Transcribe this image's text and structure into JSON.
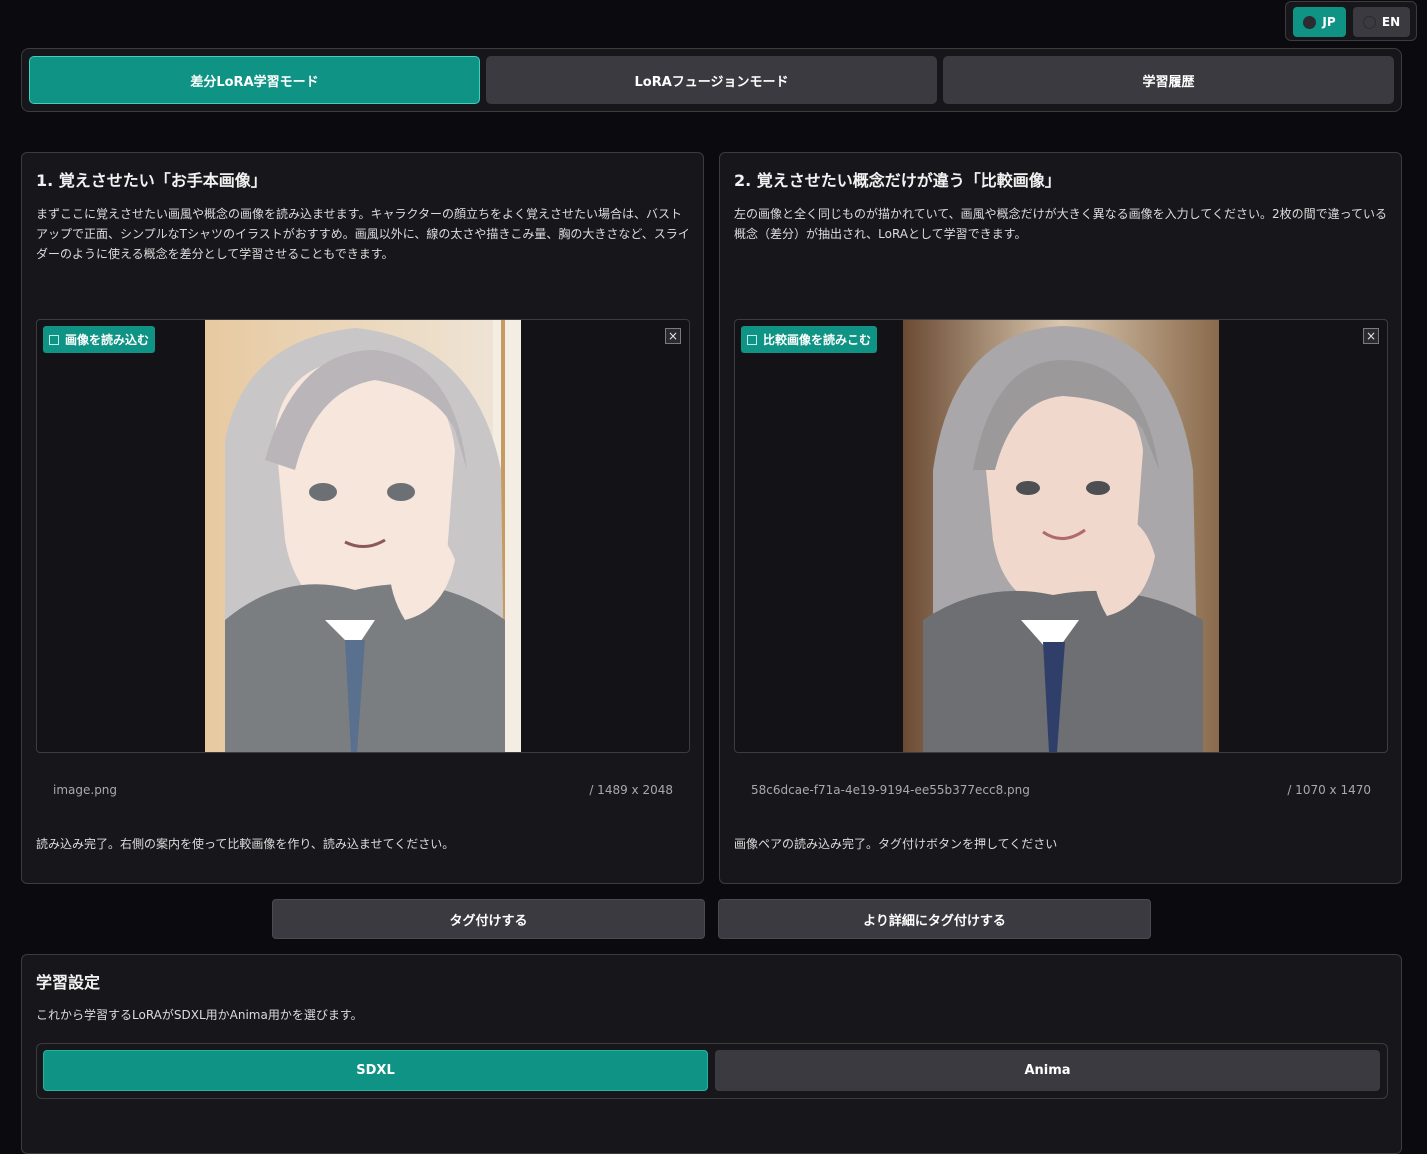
{
  "language": {
    "jp_label": "JP",
    "en_label": "EN",
    "selected": "JP"
  },
  "mode_tabs": [
    {
      "label": "差分LoRA学習モード",
      "active": true
    },
    {
      "label": "LoRAフュージョンモード",
      "active": false
    },
    {
      "label": "学習履歴",
      "active": false
    }
  ],
  "left_panel": {
    "title": "1. 覚えさせたい「お手本画像」",
    "description": "まずここに覚えさせたい画風や概念の画像を読み込ませます。キャラクターの顔立ちをよく覚えさせたい場合は、バストアップで正面、シンプルなTシャツのイラストがおすすめ。画風以外に、線の太さや描きこみ量、胸の大きさなど、スライダーのように使える概念を差分として学習させることもできます。",
    "upload_label": "画像を読み込む",
    "close_icon": "×",
    "filename": "image.png",
    "dimensions": "/ 1489 x 2048",
    "status": "読み込み完了。右側の案内を使って比較画像を作り、読み込ませてください。"
  },
  "right_panel": {
    "title": "2. 覚えさせたい概念だけが違う「比較画像」",
    "description": "左の画像と全く同じものが描かれていて、画風や概念だけが大きく異なる画像を入力してください。2枚の間で違っている概念（差分）が抽出され、LoRAとして学習できます。",
    "upload_label": "比較画像を読みこむ",
    "close_icon": "×",
    "filename": "58c6dcae-f71a-4e19-9194-ee55b377ecc8.png",
    "dimensions": "/ 1070 x 1470",
    "status": "画像ペアの読み込み完了。タグ付けボタンを押してください"
  },
  "tag_buttons": {
    "tag_label": "タグ付けする",
    "detailed_tag_label": "より詳細にタグ付けする"
  },
  "training_settings": {
    "title": "学習設定",
    "description": "これから学習するLoRAがSDXL用かAnima用かを選びます。",
    "models": [
      {
        "label": "SDXL",
        "active": true
      },
      {
        "label": "Anima",
        "active": false
      }
    ]
  },
  "colors": {
    "accent": "#0e9384",
    "background": "#0b0b0f",
    "panel": "#17171b",
    "button": "#3a3a40"
  }
}
